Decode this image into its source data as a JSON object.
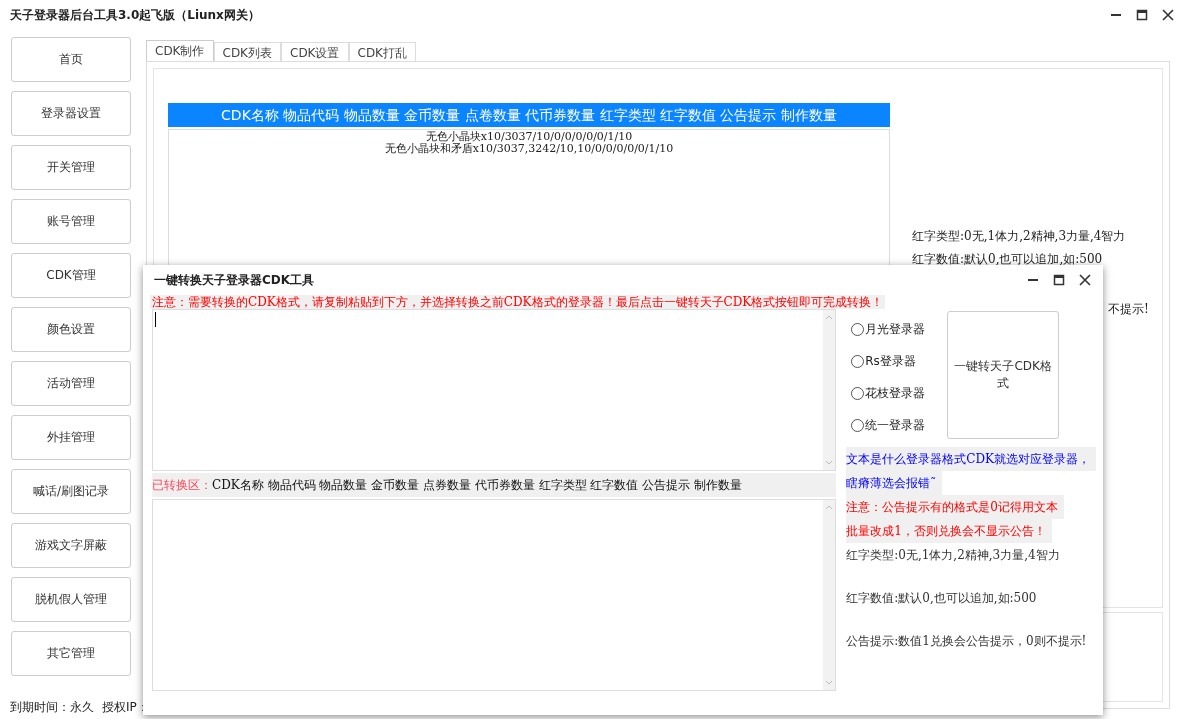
{
  "window": {
    "title": "天子登录器后台工具3.0起飞版（Liunx网关）"
  },
  "sidebar": {
    "items": [
      {
        "label": "首页"
      },
      {
        "label": "登录器设置"
      },
      {
        "label": "开关管理"
      },
      {
        "label": "账号管理"
      },
      {
        "label": "CDK管理"
      },
      {
        "label": "颜色设置"
      },
      {
        "label": "活动管理"
      },
      {
        "label": "外挂管理"
      },
      {
        "label": "喊话/刷图记录"
      },
      {
        "label": "游戏文字屏蔽"
      },
      {
        "label": "脱机假人管理"
      },
      {
        "label": "其它管理"
      }
    ]
  },
  "tabs": [
    {
      "label": "CDK制作",
      "selected": true
    },
    {
      "label": "CDK列表",
      "selected": false
    },
    {
      "label": "CDK设置",
      "selected": false
    },
    {
      "label": "CDK打乱",
      "selected": false
    }
  ],
  "cdk_table": {
    "header": "CDK名称 物品代码 物品数量 金币数量 点卷数量 代币券数量 红字类型 红字数值 公告提示 制作数量",
    "rows": [
      "无色小晶块x10/3037/10/0/0/0/0/0/1/10",
      "无色小晶块和矛盾x10/3037,3242/10,10/0/0/0/0/0/1/10"
    ]
  },
  "notes": [
    "红字类型:0无,1体力,2精神,3力量,4智力",
    "红字数值:默认0,也可以追加,如:500",
    "不提示!"
  ],
  "status_bar": {
    "expiry": "到期时间：永久",
    "ip": "授权IP："
  },
  "dialog": {
    "title": "一键转换天子登录器CDK工具",
    "notice": "注意：需要转换的CDK格式，请复制粘贴到下方，并选择转换之前CDK格式的登录器！最后点击一键转天子CDK格式按钮即可完成转换！",
    "converted_label": "已转换区：",
    "converted_header": "CDK名称 物品代码 物品数量 金币数量 点券数量 代币券数量 红字类型 红字数值 公告提示 制作数量",
    "options": [
      {
        "label": "月光登录器",
        "selected": false
      },
      {
        "label": "Rs登录器",
        "selected": false
      },
      {
        "label": "花枝登录器",
        "selected": false
      },
      {
        "label": "统一登录器",
        "selected": false
      }
    ],
    "convert_button": "一键转天子CDK格式",
    "hint_lines": [
      "文本是什么登录器格式CDK就选对应登录器，",
      "瞎瘠薄选会报错˜"
    ],
    "warning_lines": [
      "注意：公告提示有的格式是0记得用文本",
      "批量改成1，否则兑换会不显示公告！"
    ],
    "info": [
      "红字类型:0无,1体力,2精神,3力量,4智力",
      "红字数值:默认0,也可以追加,如:500",
      "公告提示:数值1兑换会公告提示，0则不提示!"
    ]
  }
}
